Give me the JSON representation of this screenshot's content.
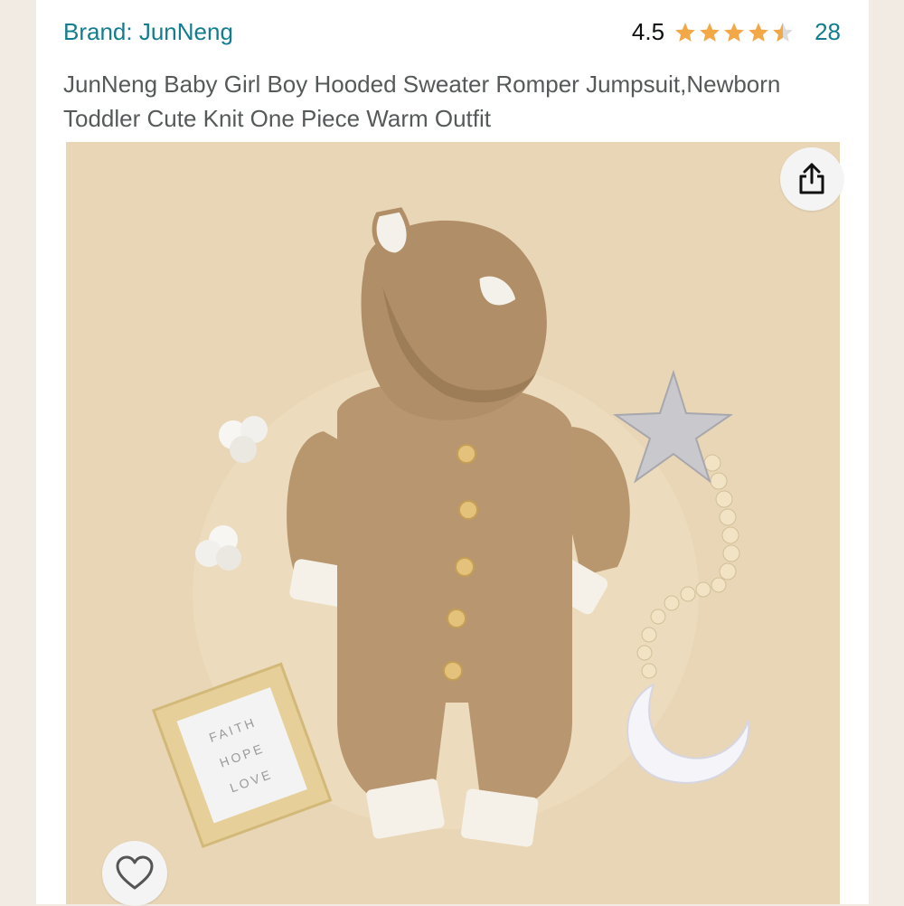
{
  "product": {
    "brand": "Brand: JunNeng",
    "rating": "4.5",
    "rating_value": 4.5,
    "review_count": "28",
    "title": "JunNeng Baby Girl Boy Hooded Sweater Romper Jumpsuit,Newborn Toddler Cute Knit One Piece Warm Outfit",
    "image": {
      "frame_text": [
        "FAITH",
        "HOPE",
        "LOVE"
      ]
    }
  },
  "actions": {
    "share_icon": "share-icon",
    "wishlist_icon": "heart-icon"
  },
  "colors": {
    "link": "#127d8f",
    "star": "#f3a847",
    "background": "#e9d6b6"
  }
}
